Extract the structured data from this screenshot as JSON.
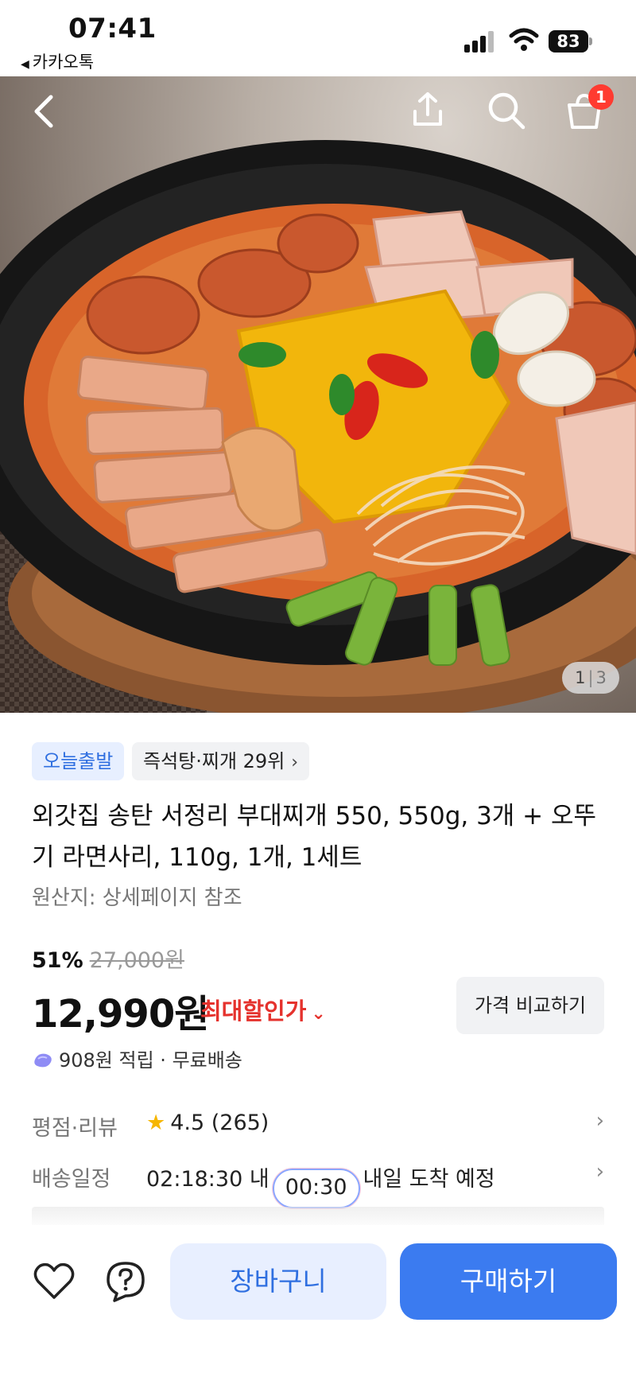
{
  "status_bar": {
    "time": "07:41",
    "back_app": "카카오톡",
    "battery": "83"
  },
  "header": {
    "cart_badge": "1"
  },
  "gallery": {
    "current": "1",
    "total": "3"
  },
  "product": {
    "tag_today": "오늘출발",
    "tag_rank": "즉석탕·찌개 29위",
    "title": "외갓집 송탄 서정리 부대찌개 550, 550g, 3개 + 오뚜기 라면사리, 110g, 1개, 1세트",
    "origin": "원산지: 상세페이지 참조",
    "discount_pct": "51%",
    "original_price": "27,000원",
    "price": "12,990원",
    "max_discount_label": "최대할인가",
    "compare_label": "가격 비교하기",
    "points_text": "908원 적립 · 무료배송"
  },
  "info_rows": {
    "rating_label": "평점·리뷰",
    "rating_value": "4.5 (265)",
    "delivery_label": "배송일정",
    "delivery_prefix": "02:18:30 내",
    "delivery_timer": "00:30",
    "delivery_suffix": "내일 도착 예정"
  },
  "bottom_bar": {
    "cart_label": "장바구니",
    "buy_label": "구매하기"
  },
  "colors": {
    "accent": "#3b7bf0",
    "discount_red": "#e5322d",
    "badge_red": "#ff3b30"
  }
}
